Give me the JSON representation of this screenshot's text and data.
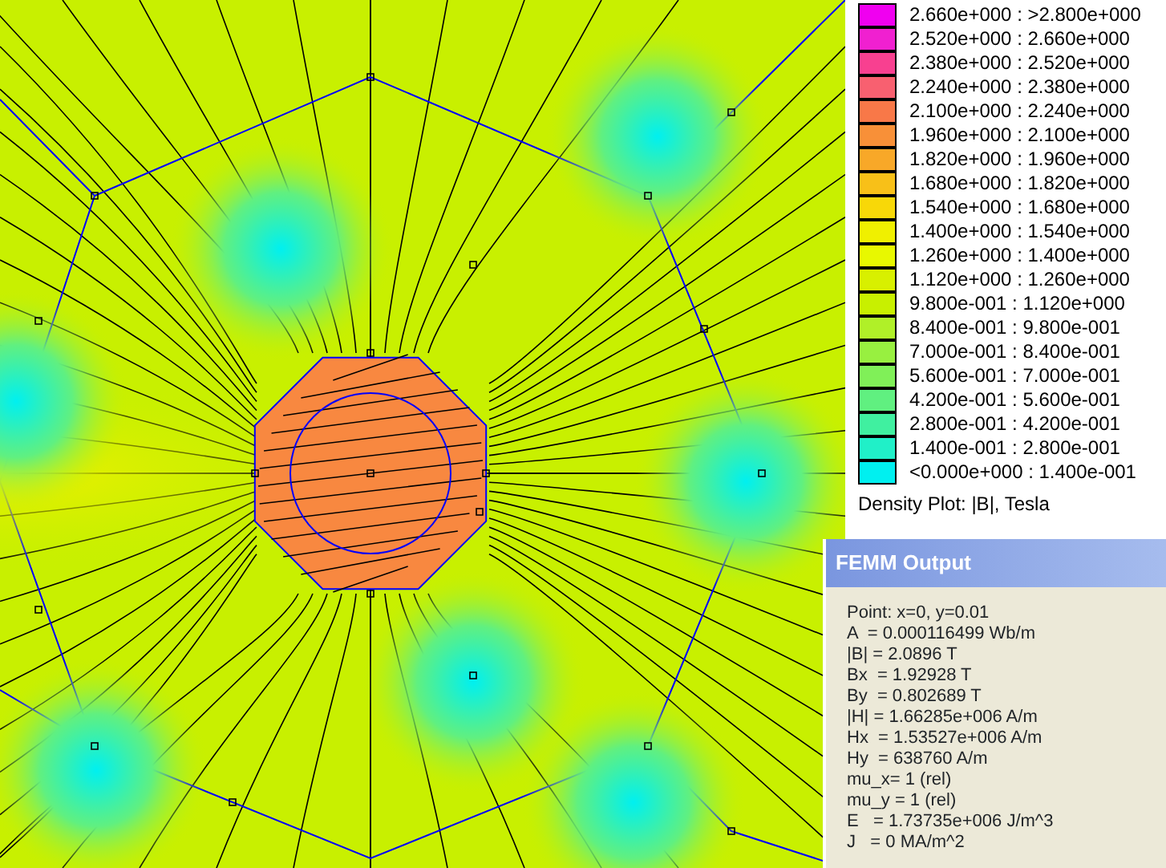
{
  "legend": {
    "entries": [
      {
        "label": "2.660e+000 : >2.800e+000",
        "color": "#f000f0"
      },
      {
        "label": "2.520e+000 : 2.660e+000",
        "color": "#f020d0"
      },
      {
        "label": "2.380e+000 : 2.520e+000",
        "color": "#f84090"
      },
      {
        "label": "2.240e+000 : 2.380e+000",
        "color": "#f86070"
      },
      {
        "label": "2.100e+000 : 2.240e+000",
        "color": "#f87848"
      },
      {
        "label": "1.960e+000 : 2.100e+000",
        "color": "#f89038"
      },
      {
        "label": "1.820e+000 : 1.960e+000",
        "color": "#f8a828"
      },
      {
        "label": "1.680e+000 : 1.820e+000",
        "color": "#f8c018"
      },
      {
        "label": "1.540e+000 : 1.680e+000",
        "color": "#f8d808"
      },
      {
        "label": "1.400e+000 : 1.540e+000",
        "color": "#f0f000"
      },
      {
        "label": "1.260e+000 : 1.400e+000",
        "color": "#e8f800"
      },
      {
        "label": "1.120e+000 : 1.260e+000",
        "color": "#d8f000"
      },
      {
        "label": "9.800e-001 : 1.120e+000",
        "color": "#c8f000"
      },
      {
        "label": "8.400e-001 : 9.800e-001",
        "color": "#b0f028"
      },
      {
        "label": "7.000e-001 : 8.400e-001",
        "color": "#98f040"
      },
      {
        "label": "5.600e-001 : 7.000e-001",
        "color": "#80f058"
      },
      {
        "label": "4.200e-001 : 5.600e-001",
        "color": "#60f080"
      },
      {
        "label": "2.800e-001 : 4.200e-001",
        "color": "#40f0a0"
      },
      {
        "label": "1.400e-001 : 2.800e-001",
        "color": "#20f0c8"
      },
      {
        "label": "<0.000e+000 : 1.400e-001",
        "color": "#00f0f0"
      }
    ],
    "caption": "Density Plot: |B|, Tesla"
  },
  "output_window": {
    "title": "FEMM Output",
    "lines": [
      "Point: x=0, y=0.01",
      "A  = 0.000116499 Wb/m",
      "|B| = 2.0896 T",
      "Bx  = 1.92928 T",
      "By  = 0.802689 T",
      "|H| = 1.66285e+006 A/m",
      "Hx  = 1.53527e+006 A/m",
      "Hy  = 638760 A/m",
      "mu_x= 1 (rel)",
      "mu_y = 1 (rel)",
      "E   = 1.73735e+006 J/m^3",
      "J   = 0 MA/m^2"
    ]
  }
}
